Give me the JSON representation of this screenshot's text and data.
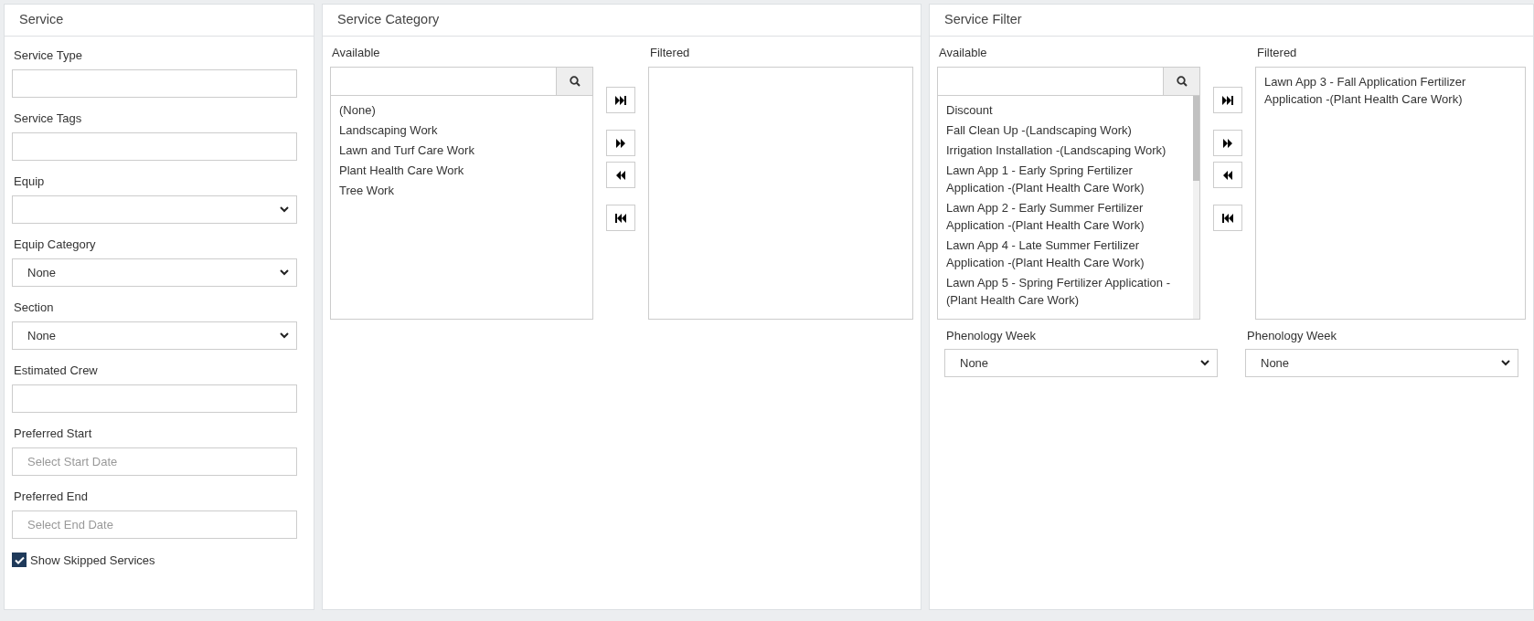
{
  "service_panel": {
    "title": "Service",
    "fields": [
      {
        "kind": "text",
        "label": "Service Type"
      },
      {
        "kind": "text",
        "label": "Service Tags"
      },
      {
        "kind": "select",
        "label": "Equip"
      },
      {
        "kind": "select",
        "label": "Equip Category",
        "value": "None"
      },
      {
        "kind": "select",
        "label": "Section",
        "value": "None"
      },
      {
        "kind": "text",
        "label": "Estimated Crew"
      },
      {
        "kind": "text",
        "label": "Preferred Start",
        "placeholder": "Select Start Date"
      },
      {
        "kind": "text",
        "label": "Preferred End",
        "placeholder": "Select End Date"
      }
    ],
    "checkbox": {
      "label": "Show Skipped Services",
      "checked": true
    }
  },
  "category_panel": {
    "title": "Service Category",
    "available": {
      "label": "Available",
      "scrollbar": false,
      "items": [
        "(None)",
        "Landscaping Work",
        "Lawn and Turf Care Work",
        "Plant Health Care Work",
        "Tree Work"
      ]
    },
    "filtered": {
      "label": "Filtered"
    }
  },
  "filter_panel": {
    "title": "Service Filter",
    "available": {
      "label": "Available",
      "scrollbar": true,
      "items": [
        "Discount",
        "Fall Clean Up -(Landscaping Work)",
        "Irrigation Installation -(Landscaping Work)",
        "Lawn App 1 - Early Spring Fertilizer Application -(Plant Health Care Work)",
        "Lawn App 2 - Early Summer Fertilizer Application -(Plant Health Care Work)",
        "Lawn App 4 - Late Summer Fertilizer Application -(Plant Health Care Work)",
        "Lawn App 5 - Spring Fertilizer Application -(Plant Health Care Work)"
      ]
    },
    "filtered": {
      "label": "Filtered",
      "items": [
        "Lawn App 3 - Fall Application Fertilizer Application -(Plant Health Care Work)"
      ]
    },
    "selects": [
      {
        "label": "Phenology Week",
        "value": "None"
      },
      {
        "label": "Phenology Week",
        "value": "None"
      }
    ]
  }
}
